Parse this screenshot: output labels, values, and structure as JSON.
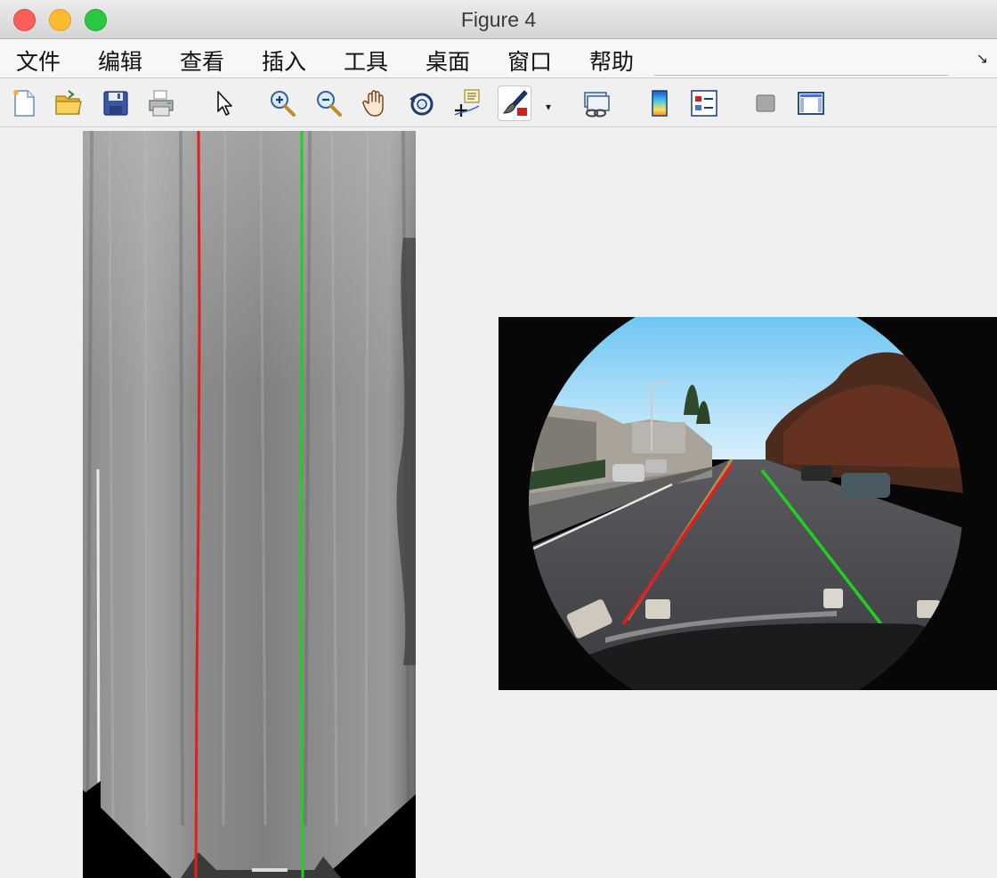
{
  "window": {
    "title": "Figure 4"
  },
  "menu": {
    "items": [
      "文件",
      "编辑",
      "查看",
      "插入",
      "工具",
      "桌面",
      "窗口",
      "帮助"
    ],
    "overflow_icon": "chevron-corner-icon"
  },
  "toolbar": {
    "buttons": [
      {
        "name": "new-figure-icon"
      },
      {
        "name": "open-file-icon"
      },
      {
        "name": "save-icon"
      },
      {
        "name": "print-icon"
      },
      {
        "name": "edit-plot-arrow-icon"
      },
      {
        "name": "zoom-in-icon"
      },
      {
        "name": "zoom-out-icon"
      },
      {
        "name": "pan-hand-icon"
      },
      {
        "name": "rotate-3d-icon"
      },
      {
        "name": "data-cursor-icon"
      },
      {
        "name": "brush-icon"
      },
      {
        "name": "link-plot-icon"
      },
      {
        "name": "colorbar-icon"
      },
      {
        "name": "legend-icon"
      },
      {
        "name": "hide-plot-tools-icon"
      },
      {
        "name": "show-plot-tools-icon"
      }
    ],
    "active": "brush-icon"
  },
  "figures": {
    "left": {
      "description_color": "#808080"
    },
    "right": {
      "description_color": "#000000"
    }
  },
  "colors": {
    "left_lane": "#e0201e",
    "right_lane": "#20d020"
  }
}
